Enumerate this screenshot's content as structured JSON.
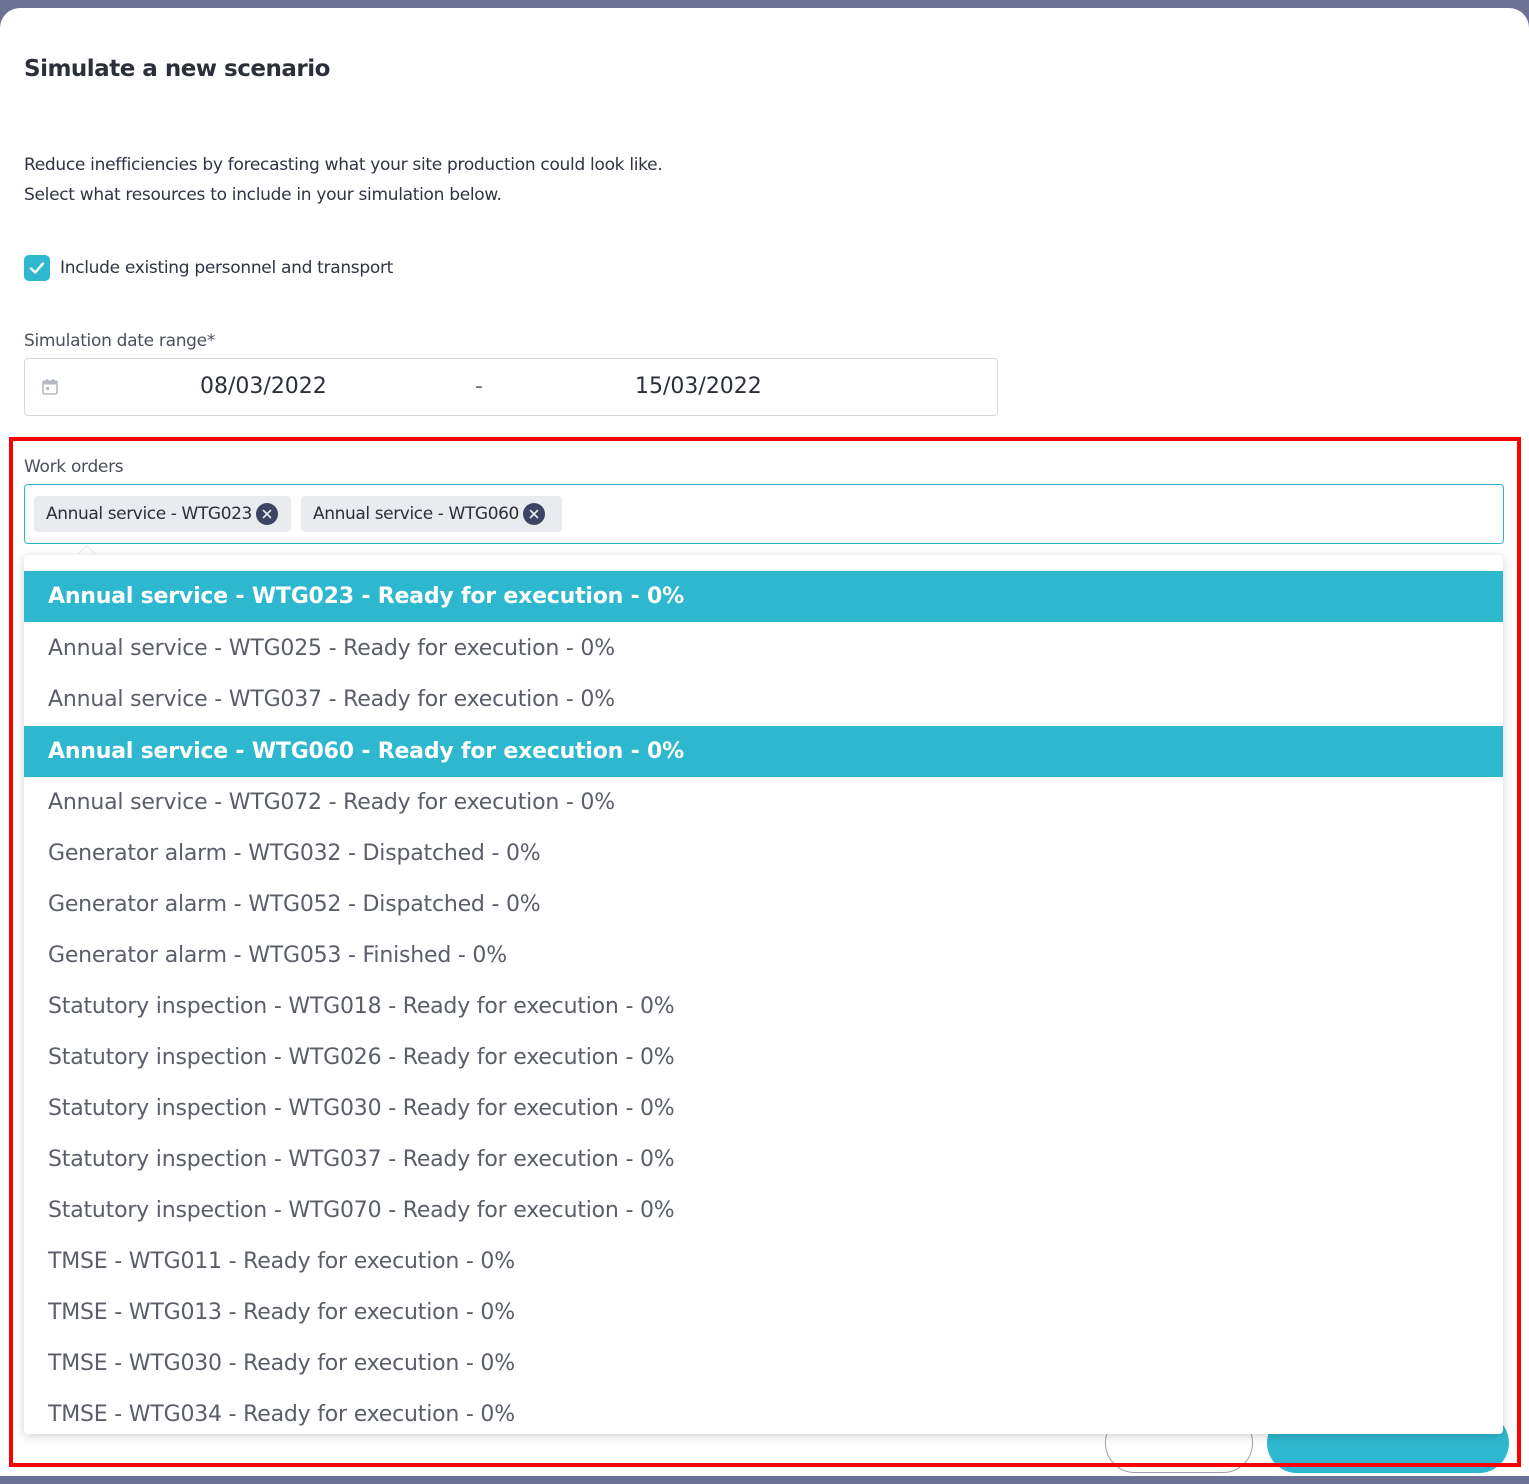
{
  "dialog": {
    "title": "Simulate a new scenario",
    "description_line1": "Reduce inefficiencies by forecasting what your site production could look like.",
    "description_line2": "Select what resources to include in your simulation below."
  },
  "include_checkbox": {
    "label": "Include existing personnel and transport",
    "checked": true
  },
  "date_range": {
    "label": "Simulation date range*",
    "start": "08/03/2022",
    "separator": "-",
    "end": "15/03/2022"
  },
  "work_orders": {
    "label": "Work orders",
    "selected_chips": [
      "Annual service - WTG023",
      "Annual service - WTG060"
    ],
    "options": [
      {
        "label": "Annual service - WTG023 - Ready for execution - 0%",
        "selected": true
      },
      {
        "label": "Annual service - WTG025 - Ready for execution - 0%",
        "selected": false
      },
      {
        "label": "Annual service - WTG037 - Ready for execution - 0%",
        "selected": false
      },
      {
        "label": "Annual service - WTG060 - Ready for execution - 0%",
        "selected": true
      },
      {
        "label": "Annual service - WTG072 - Ready for execution - 0%",
        "selected": false
      },
      {
        "label": "Generator alarm - WTG032 - Dispatched - 0%",
        "selected": false
      },
      {
        "label": "Generator alarm - WTG052 - Dispatched - 0%",
        "selected": false
      },
      {
        "label": "Generator alarm - WTG053 - Finished - 0%",
        "selected": false
      },
      {
        "label": "Statutory inspection - WTG018 - Ready for execution - 0%",
        "selected": false
      },
      {
        "label": "Statutory inspection - WTG026 - Ready for execution - 0%",
        "selected": false
      },
      {
        "label": "Statutory inspection - WTG030 - Ready for execution - 0%",
        "selected": false
      },
      {
        "label": "Statutory inspection - WTG037 - Ready for execution - 0%",
        "selected": false
      },
      {
        "label": "Statutory inspection - WTG070 - Ready for execution - 0%",
        "selected": false
      },
      {
        "label": "TMSE - WTG011 - Ready for execution - 0%",
        "selected": false
      },
      {
        "label": "TMSE - WTG013 - Ready for execution - 0%",
        "selected": false
      },
      {
        "label": "TMSE - WTG030 - Ready for execution - 0%",
        "selected": false
      },
      {
        "label": "TMSE - WTG034 - Ready for execution - 0%",
        "selected": false
      }
    ]
  },
  "colors": {
    "accent": "#2eb8cf",
    "chip_close": "#3d4463",
    "highlight_box": "#ff0000",
    "backdrop": "#6b7394"
  },
  "icons": {
    "checkbox": "check-icon",
    "date": "calendar-icon",
    "chip_remove": "close-circle-icon"
  }
}
